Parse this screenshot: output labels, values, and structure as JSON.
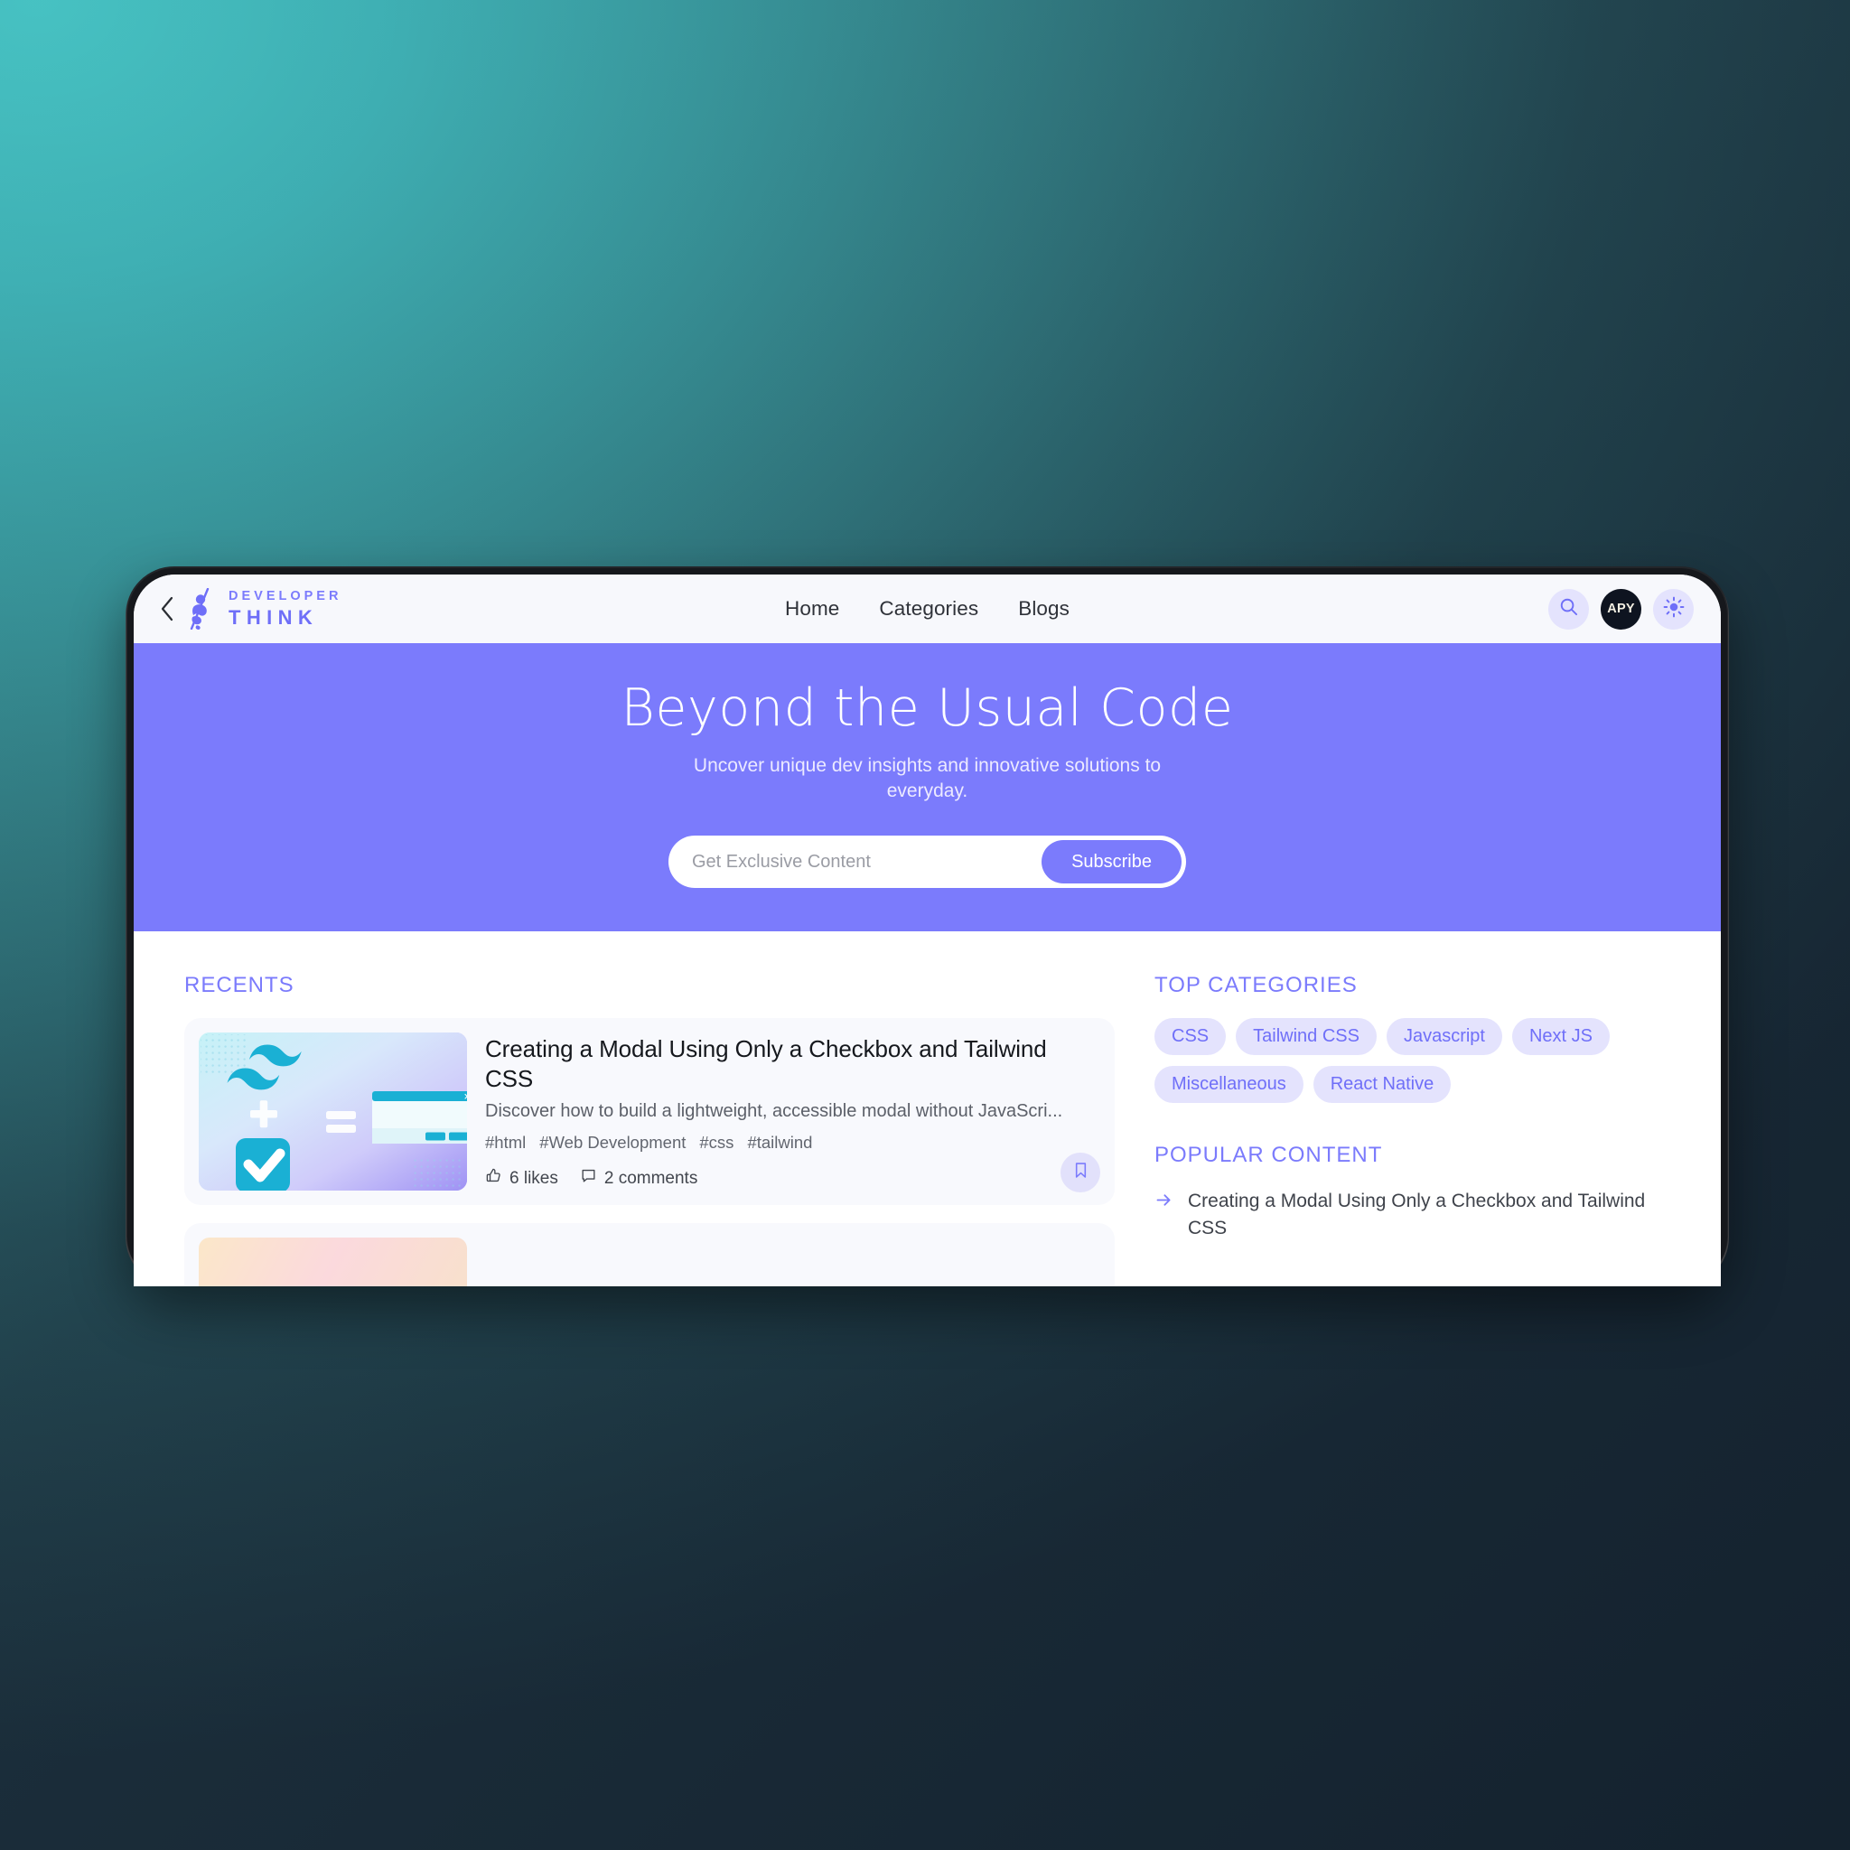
{
  "header": {
    "back_icon": "chevron-left-icon",
    "brand_top": "DEVELOPER",
    "brand_bottom": "THINK",
    "nav": [
      {
        "label": "Home"
      },
      {
        "label": "Categories"
      },
      {
        "label": "Blogs"
      }
    ],
    "actions": {
      "search_icon": "search-icon",
      "avatar_label": "APY",
      "theme_icon": "sun-icon"
    }
  },
  "hero": {
    "title": "Beyond the Usual Code",
    "subtitle": "Uncover unique dev insights and innovative solutions to everyday.",
    "subscribe_placeholder": "Get Exclusive Content",
    "subscribe_value": "",
    "subscribe_button": "Subscribe",
    "background_color": "#7b7bfc"
  },
  "main": {
    "section_label": "RECENTS",
    "articles": [
      {
        "title": "Creating a Modal Using Only a Checkbox and Tailwind CSS",
        "description": "Discover how to build a lightweight, accessible modal without JavaScri...",
        "tags": [
          "#html",
          "#Web Development",
          "#css",
          "#tailwind"
        ],
        "likes": "6 likes",
        "comments": "2 comments",
        "like_icon": "thumbs-up-icon",
        "comment_icon": "comment-icon",
        "bookmark_icon": "bookmark-icon",
        "thumbnail": "tailwind-plus-checkbox-equals-modal"
      },
      {
        "title": "",
        "description": "",
        "tags": [],
        "likes": "",
        "comments": "",
        "like_icon": "thumbs-up-icon",
        "comment_icon": "comment-icon",
        "bookmark_icon": "bookmark-icon",
        "thumbnail": "peach-gradient-thumbnail"
      }
    ]
  },
  "sidebar": {
    "categories_label": "TOP CATEGORIES",
    "categories": [
      {
        "label": "CSS"
      },
      {
        "label": "Tailwind CSS"
      },
      {
        "label": "Javascript"
      },
      {
        "label": "Next JS"
      },
      {
        "label": "Miscellaneous"
      },
      {
        "label": "React Native"
      }
    ],
    "popular_label": "POPULAR CONTENT",
    "popular": [
      {
        "label": "Creating a Modal Using Only a Checkbox and Tailwind CSS",
        "arrow_icon": "arrow-right-icon"
      }
    ]
  },
  "theme": {
    "accent": "#7b7bfc",
    "accent_soft": "#e4e3fd",
    "page_bg_from": "#47bfc0",
    "page_bg_to": "#1b2b38"
  }
}
